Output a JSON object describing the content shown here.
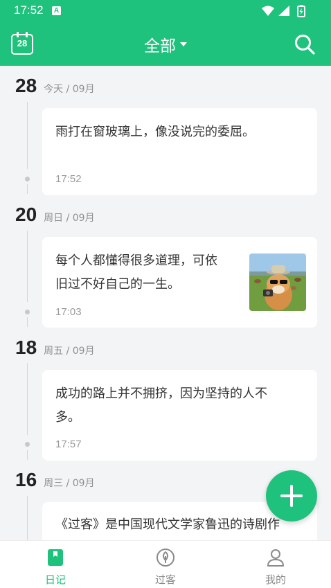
{
  "status": {
    "time": "17:52",
    "badge": "A"
  },
  "header": {
    "calendar_day": "28",
    "title": "全部"
  },
  "entries": [
    {
      "day": "28",
      "sub": "今天 / 09月",
      "text_lines": [
        "雨打在窗玻璃上，像没说完的委屈。"
      ],
      "time": "17:52",
      "has_image": false
    },
    {
      "day": "20",
      "sub": "周日 / 09月",
      "text_lines": [
        "每个人都懂得很多道理，可依",
        "旧过不好自己的一生。"
      ],
      "time": "17:03",
      "has_image": true
    },
    {
      "day": "18",
      "sub": "周五 / 09月",
      "text_lines": [
        "成功的路上并不拥挤，因为坚持的人不",
        "多。"
      ],
      "time": "17:57",
      "has_image": false
    },
    {
      "day": "16",
      "sub": "周三 / 09月",
      "text_lines": [
        "《过客》是中国现代文学家鲁迅的诗剧作"
      ],
      "time": "",
      "has_image": false
    }
  ],
  "bottom_nav": [
    {
      "label": "日记",
      "icon": "diary-icon",
      "active": true
    },
    {
      "label": "过客",
      "icon": "leaf-icon",
      "active": false
    },
    {
      "label": "我的",
      "icon": "person-icon",
      "active": false
    }
  ],
  "colors": {
    "accent": "#1fc27d",
    "background": "#f3f4f6"
  }
}
